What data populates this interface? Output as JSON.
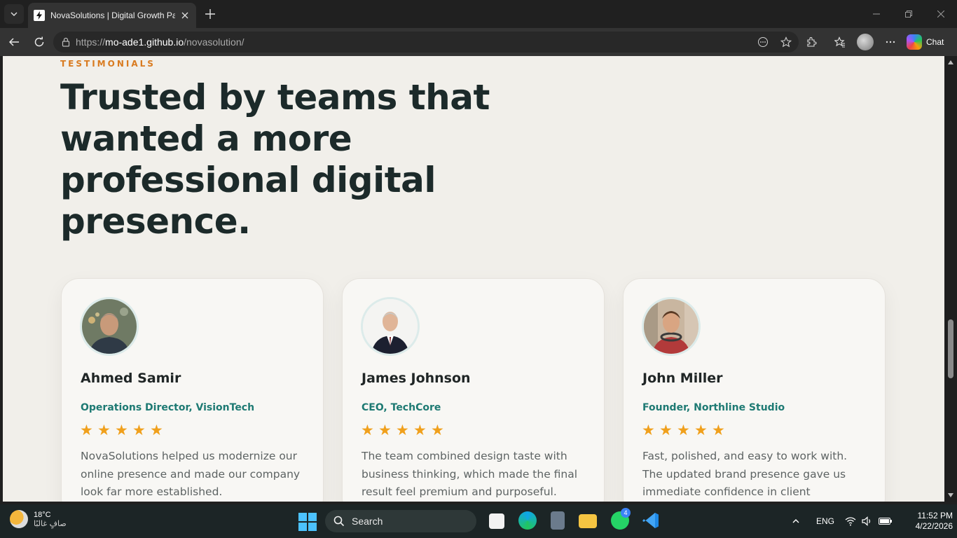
{
  "browser": {
    "tab": {
      "title": "NovaSolutions | Digital Growth Pa",
      "favicon": "lightning-icon"
    },
    "url": {
      "scheme": "https://",
      "host": "mo-ade1.github.io",
      "path": "/novasolution/"
    },
    "chat_label": "Chat"
  },
  "section": {
    "eyebrow": "TESTIMONIALS",
    "headline": "Trusted by teams that wanted a more professional digital presence."
  },
  "testimonials": [
    {
      "name": "Ahmed Samir",
      "role": "Operations Director, VisionTech",
      "rating": 5,
      "quote": "NovaSolutions helped us modernize our online presence and made our company look far more established."
    },
    {
      "name": "James Johnson",
      "role": "CEO, TechCore",
      "rating": 5,
      "quote": "The team combined design taste with business thinking, which made the final result feel premium and purposeful."
    },
    {
      "name": "John Miller",
      "role": "Founder, Northline Studio",
      "rating": 5,
      "quote": "Fast, polished, and easy to work with. The updated brand presence gave us immediate confidence in client meetings."
    }
  ],
  "taskbar": {
    "weather_temp": "18°C",
    "weather_desc": "صافٍ غالبًا",
    "search_label": "Search",
    "language": "ENG",
    "whatsapp_badge": "4",
    "time": "11:52 PM",
    "date": "4/22/2026"
  },
  "colors": {
    "accent_orange": "#d97b20",
    "heading": "#1c2a2a",
    "role_teal": "#1e7a73",
    "star": "#f0a01c",
    "page_bg": "#f1efea"
  }
}
